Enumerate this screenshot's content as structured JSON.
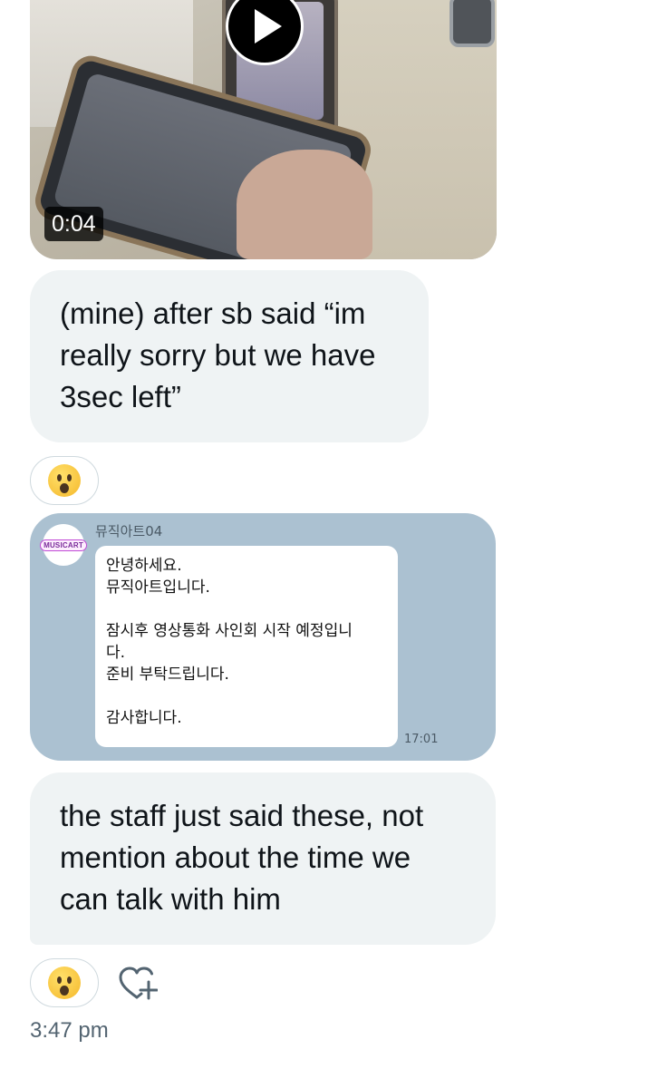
{
  "video": {
    "duration": "0:04",
    "play_icon": "play-icon"
  },
  "messages": [
    {
      "text": "(mine) after sb said “im really sorry but we have 3sec left”"
    },
    {
      "text": "the staff just said these, not mention about the time we can talk with him"
    }
  ],
  "reactions": [
    {
      "emoji": "astonished-face-icon"
    },
    {
      "emoji": "astonished-face-icon"
    }
  ],
  "embedded_chat": {
    "sender": "뮤직아트04",
    "avatar_logo": "MUSICART",
    "message": "안녕하세요.\n뮤직아트입니다.\n\n잠시후 영상통화 사인회 시작 예정입니\n다.\n준비 부탁드립니다.\n\n감사합니다.",
    "time": "17:01"
  },
  "add_reaction_icon": "heart-plus-icon",
  "timestamp": "3:47 pm",
  "colors": {
    "bubble_bg": "#eff3f4",
    "text": "#0f1419",
    "muted": "#536471",
    "kakao_bg": "#abc1d1"
  }
}
